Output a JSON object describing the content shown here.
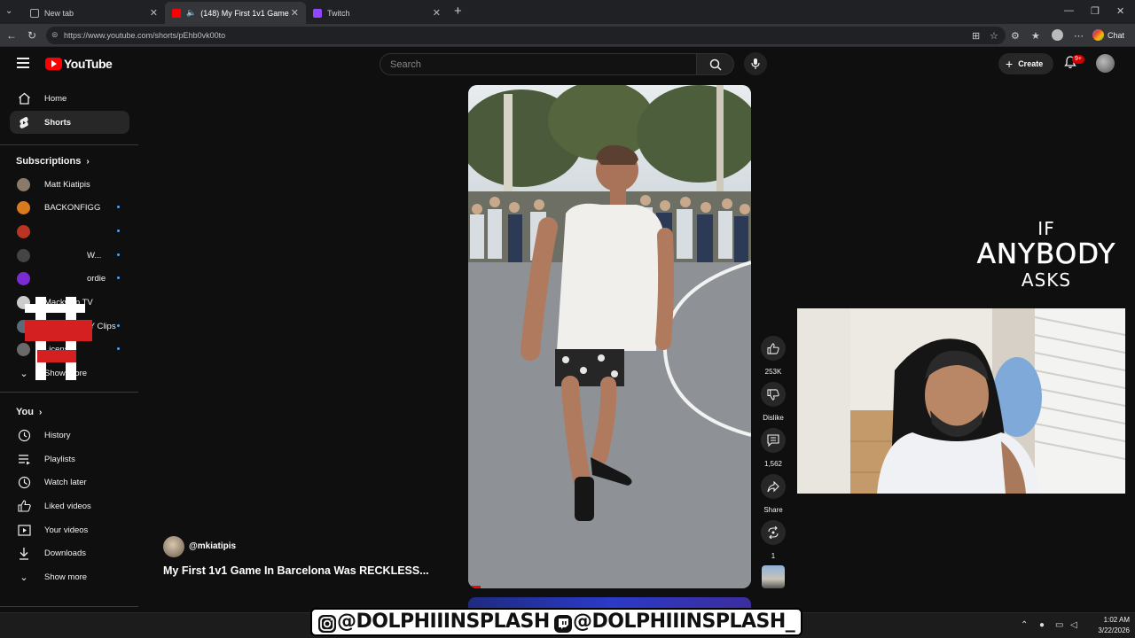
{
  "browser": {
    "tabs": [
      {
        "title": "New tab",
        "active": false
      },
      {
        "title": "(148) My First 1v1 Game In Ba",
        "active": true
      },
      {
        "title": "Twitch",
        "active": false
      }
    ],
    "url": "https://www.youtube.com/shorts/pEhb0vk00to",
    "chat_label": "Chat"
  },
  "youtube": {
    "logo_text": "YouTube",
    "search_placeholder": "Search",
    "create_label": "Create",
    "notification_badge": "9+",
    "sidebar": {
      "main": [
        {
          "label": "Home",
          "icon": "home-icon"
        },
        {
          "label": "Shorts",
          "icon": "shorts-icon",
          "active": true
        }
      ],
      "subscriptions_heading": "Subscriptions",
      "subscriptions": [
        {
          "label": "Matt Kiatipis",
          "color": "#8a7a6a"
        },
        {
          "label": "BACKONFIGG",
          "color": "#d97a1e"
        },
        {
          "label": "",
          "color": "#bb3322"
        },
        {
          "label": "W...",
          "color": "#444444"
        },
        {
          "label": "ordie",
          "color": "#7a2bd1"
        },
        {
          "label": "Mackwop TV",
          "color": "#cccccc"
        },
        {
          "label": "CUHMUNITY Clips",
          "color": "#5a6b7a"
        },
        {
          "label": "License",
          "color": "#6a6a6a"
        }
      ],
      "subs_show_more": "Show more",
      "you_heading": "You",
      "you": [
        {
          "label": "History",
          "icon": "history-icon"
        },
        {
          "label": "Playlists",
          "icon": "playlists-icon"
        },
        {
          "label": "Watch later",
          "icon": "watch-later-icon"
        },
        {
          "label": "Liked videos",
          "icon": "liked-videos-icon"
        },
        {
          "label": "Your videos",
          "icon": "your-videos-icon"
        },
        {
          "label": "Downloads",
          "icon": "downloads-icon"
        }
      ],
      "you_show_more": "Show more"
    },
    "short": {
      "channel_handle": "@mkiatipis",
      "title": "My First 1v1 Game In Barcelona Was RECKLESS...",
      "progress_fraction": 0.045,
      "actions": {
        "likes": "253K",
        "dislike": "Dislike",
        "comments": "1,562",
        "share": "Share",
        "remix": "1"
      }
    }
  },
  "overlay": {
    "anybody_line1": "IF",
    "anybody_line2": "ANYBODY",
    "anybody_line3": "ASKS",
    "instagram_handle": "@DOLPHIIINSPLASH",
    "twitch_handle": "@DOLPHIIINSPLASH_"
  },
  "taskbar": {
    "time": "1:02 AM",
    "date": "3/22/2026"
  }
}
